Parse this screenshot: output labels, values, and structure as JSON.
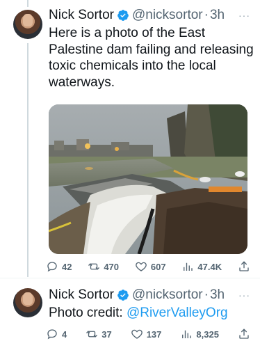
{
  "colors": {
    "verified_blue": "#1d9bf0",
    "muted_gray": "#536471",
    "link_blue": "#1d9bf0"
  },
  "tweets": [
    {
      "author": "Nick Sortor",
      "handle": "@nicksortor",
      "time": "3h",
      "separator": "·",
      "more": "···",
      "text": "Here is a photo of the East Palestine dam failing and releasing toxic chemicals into the local waterways.",
      "has_photo": true,
      "icons": [
        "reply-icon",
        "retweet-icon",
        "like-icon",
        "views-icon",
        "share-icon"
      ],
      "metrics": {
        "replies": "42",
        "retweets": "470",
        "likes": "607",
        "views": "47.4K"
      }
    },
    {
      "author": "Nick Sortor",
      "handle": "@nicksortor",
      "time": "3h",
      "separator": "·",
      "more": "···",
      "text_prefix": "Photo credit: ",
      "text_link": "@RiverValleyOrg",
      "icons": [
        "reply-icon",
        "retweet-icon",
        "like-icon",
        "views-icon",
        "share-icon"
      ],
      "metrics": {
        "replies": "4",
        "retweets": "37",
        "likes": "137",
        "views": "8,325"
      }
    }
  ]
}
